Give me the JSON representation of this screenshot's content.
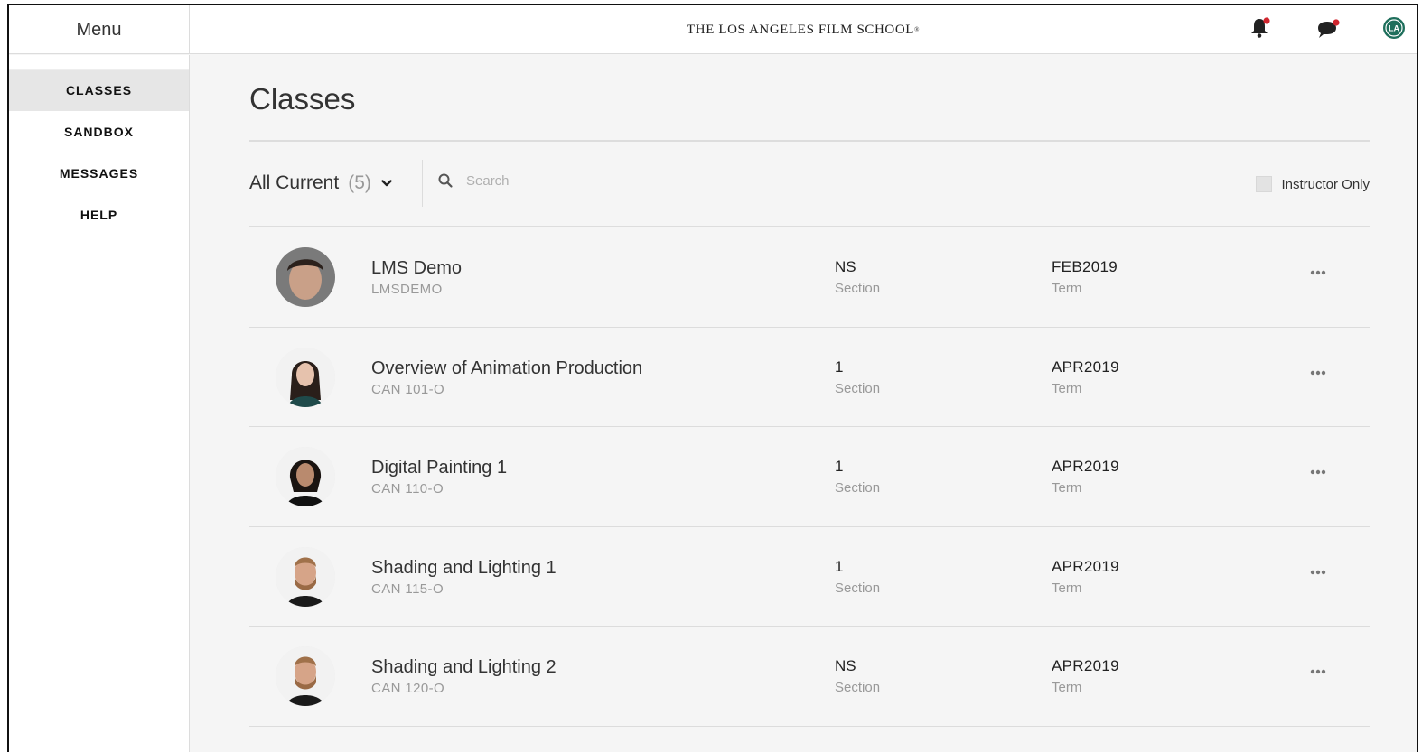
{
  "header": {
    "menu_label": "Menu",
    "brand": "THE LOS ANGELES FILM SCHOOL",
    "brand_mark": "®",
    "avatar_text": "LA"
  },
  "sidebar": {
    "items": [
      {
        "label": "CLASSES",
        "active": true
      },
      {
        "label": "SANDBOX",
        "active": false
      },
      {
        "label": "MESSAGES",
        "active": false
      },
      {
        "label": "HELP",
        "active": false
      }
    ]
  },
  "main": {
    "title": "Classes",
    "filter": {
      "label": "All Current",
      "count": "(5)"
    },
    "search": {
      "placeholder": "Search",
      "value": ""
    },
    "instructor_only": {
      "label": "Instructor Only",
      "checked": false
    },
    "classes": [
      {
        "name": "LMS Demo",
        "code": "LMSDEMO",
        "section": "NS",
        "section_label": "Section",
        "term": "FEB2019",
        "term_label": "Term"
      },
      {
        "name": "Overview of Animation Production",
        "code": "CAN 101-O",
        "section": "1",
        "section_label": "Section",
        "term": "APR2019",
        "term_label": "Term"
      },
      {
        "name": "Digital Painting 1",
        "code": "CAN 110-O",
        "section": "1",
        "section_label": "Section",
        "term": "APR2019",
        "term_label": "Term"
      },
      {
        "name": "Shading and Lighting 1",
        "code": "CAN 115-O",
        "section": "1",
        "section_label": "Section",
        "term": "APR2019",
        "term_label": "Term"
      },
      {
        "name": "Shading and Lighting 2",
        "code": "CAN 120-O",
        "section": "NS",
        "section_label": "Section",
        "term": "APR2019",
        "term_label": "Term"
      }
    ]
  },
  "colors": {
    "notification_dot": "#d0262f",
    "active_nav_bg": "#e6e6e6",
    "content_bg": "#f5f5f5",
    "avatar_badge": "#1f6f5c"
  }
}
